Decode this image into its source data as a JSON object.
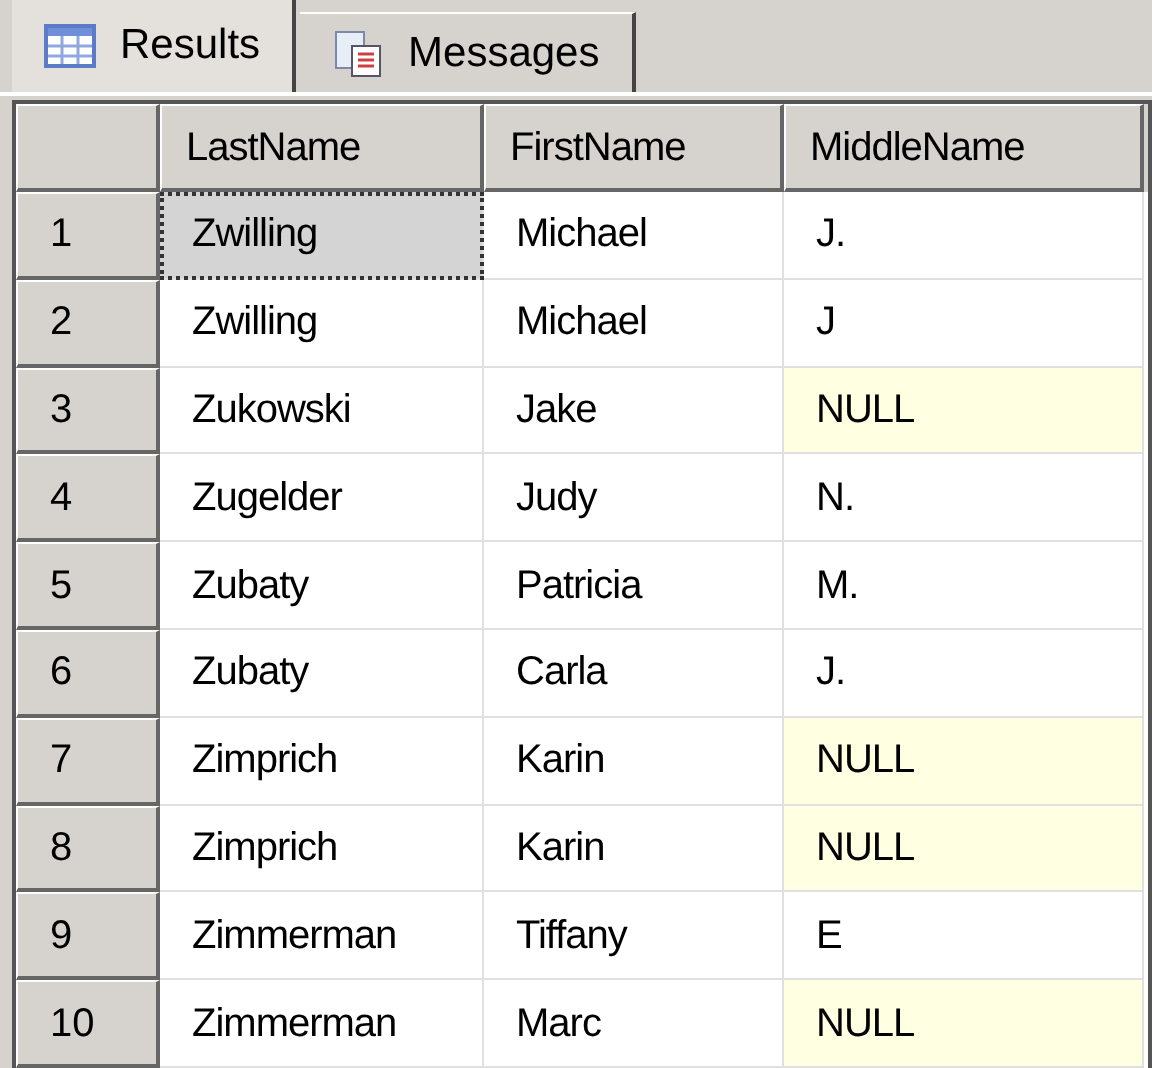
{
  "tabs": [
    {
      "label": "Results",
      "selected": true
    },
    {
      "label": "Messages",
      "selected": false
    }
  ],
  "grid": {
    "columns": [
      "LastName",
      "FirstName",
      "MiddleName"
    ],
    "rows": [
      {
        "number": "1",
        "cells": [
          {
            "text": "Zwilling",
            "kind": "value",
            "selected": true
          },
          {
            "text": "Michael",
            "kind": "value",
            "selected": false
          },
          {
            "text": "J.",
            "kind": "value",
            "selected": false
          }
        ]
      },
      {
        "number": "2",
        "cells": [
          {
            "text": "Zwilling",
            "kind": "value",
            "selected": false
          },
          {
            "text": "Michael",
            "kind": "value",
            "selected": false
          },
          {
            "text": "J",
            "kind": "value",
            "selected": false
          }
        ]
      },
      {
        "number": "3",
        "cells": [
          {
            "text": "Zukowski",
            "kind": "value",
            "selected": false
          },
          {
            "text": "Jake",
            "kind": "value",
            "selected": false
          },
          {
            "text": "NULL",
            "kind": "null",
            "selected": false
          }
        ]
      },
      {
        "number": "4",
        "cells": [
          {
            "text": "Zugelder",
            "kind": "value",
            "selected": false
          },
          {
            "text": "Judy",
            "kind": "value",
            "selected": false
          },
          {
            "text": "N.",
            "kind": "value",
            "selected": false
          }
        ]
      },
      {
        "number": "5",
        "cells": [
          {
            "text": "Zubaty",
            "kind": "value",
            "selected": false
          },
          {
            "text": "Patricia",
            "kind": "value",
            "selected": false
          },
          {
            "text": "M.",
            "kind": "value",
            "selected": false
          }
        ]
      },
      {
        "number": "6",
        "cells": [
          {
            "text": "Zubaty",
            "kind": "value",
            "selected": false
          },
          {
            "text": "Carla",
            "kind": "value",
            "selected": false
          },
          {
            "text": "J.",
            "kind": "value",
            "selected": false
          }
        ]
      },
      {
        "number": "7",
        "cells": [
          {
            "text": "Zimprich",
            "kind": "value",
            "selected": false
          },
          {
            "text": "Karin",
            "kind": "value",
            "selected": false
          },
          {
            "text": "NULL",
            "kind": "null",
            "selected": false
          }
        ]
      },
      {
        "number": "8",
        "cells": [
          {
            "text": "Zimprich",
            "kind": "value",
            "selected": false
          },
          {
            "text": "Karin",
            "kind": "value",
            "selected": false
          },
          {
            "text": "NULL",
            "kind": "null",
            "selected": false
          }
        ]
      },
      {
        "number": "9",
        "cells": [
          {
            "text": "Zimmerman",
            "kind": "value",
            "selected": false
          },
          {
            "text": "Tiffany",
            "kind": "value",
            "selected": false
          },
          {
            "text": "E",
            "kind": "value",
            "selected": false
          }
        ]
      },
      {
        "number": "10",
        "cells": [
          {
            "text": "Zimmerman",
            "kind": "value",
            "selected": false
          },
          {
            "text": "Marc",
            "kind": "value",
            "selected": false
          },
          {
            "text": "NULL",
            "kind": "null",
            "selected": false
          }
        ]
      }
    ]
  }
}
